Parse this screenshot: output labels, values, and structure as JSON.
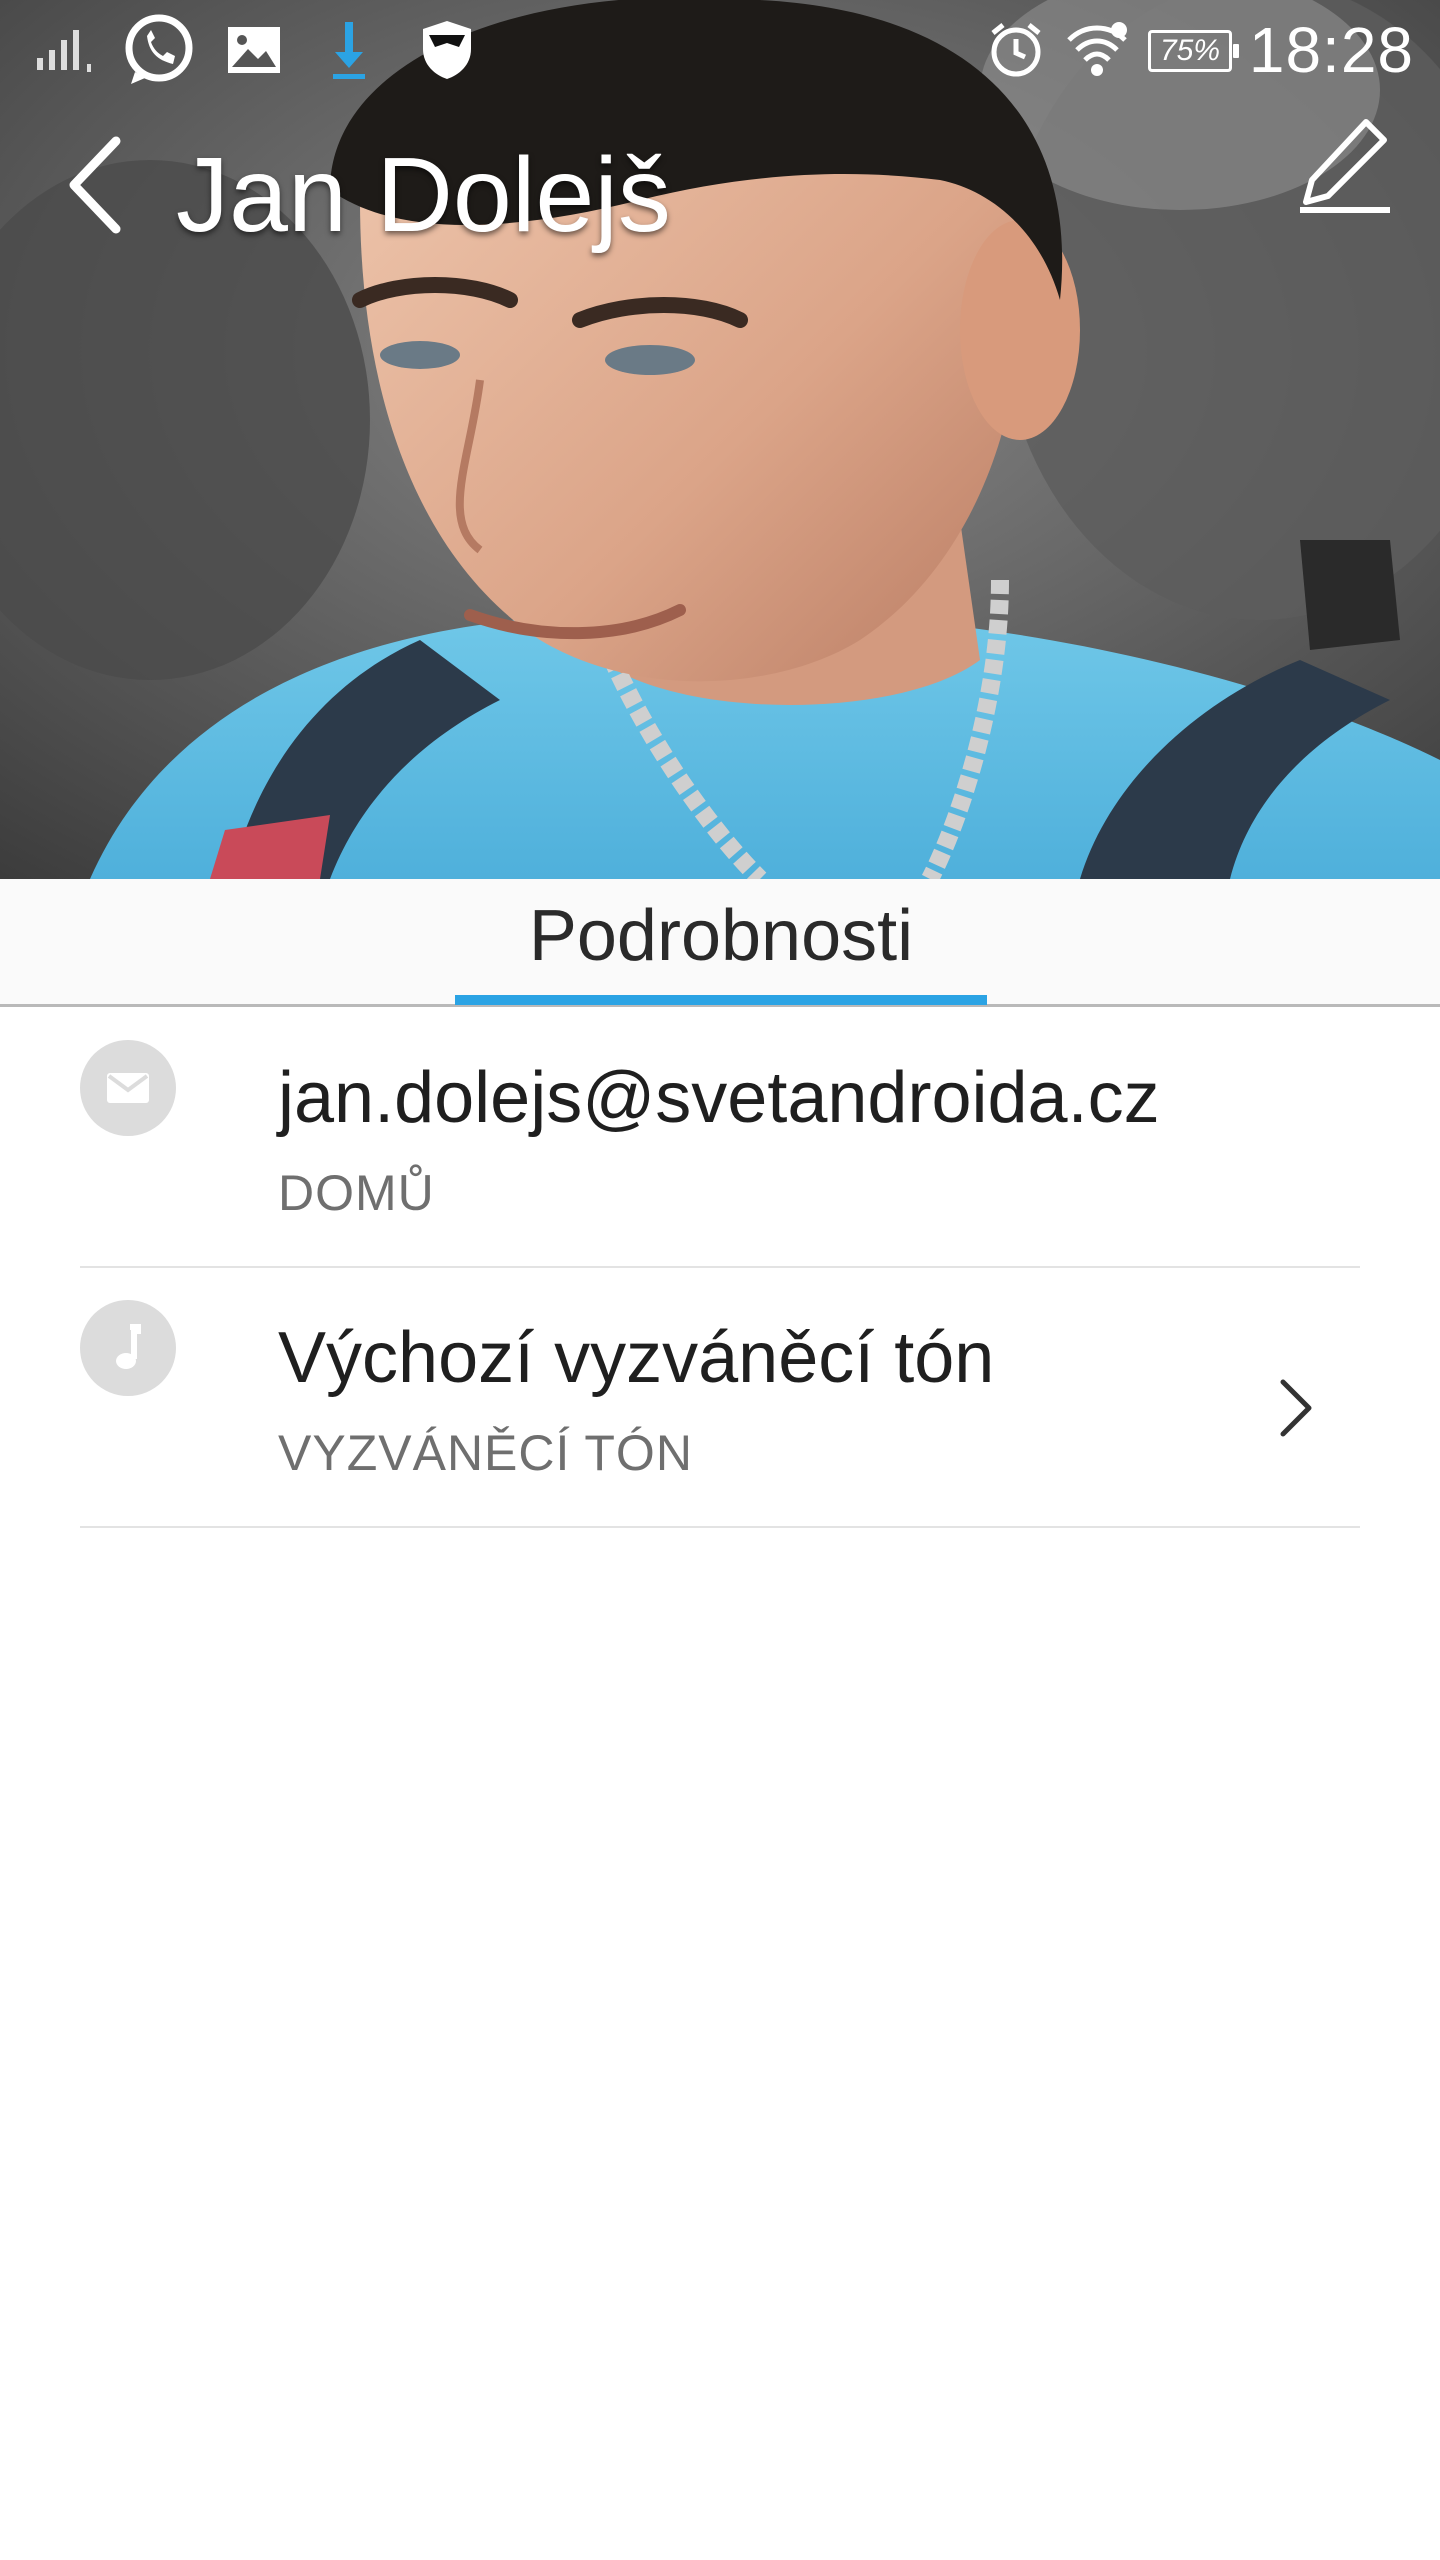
{
  "status_bar": {
    "time": "18:28",
    "battery_percent": "75%",
    "icons": [
      "signal-icon",
      "whatsapp-icon",
      "gallery-icon",
      "download-icon",
      "shield-icon",
      "alarm-icon",
      "wifi-icon",
      "battery-icon"
    ]
  },
  "header": {
    "contact_name": "Jan Dolejš",
    "back_icon": "back-arrow-icon",
    "edit_icon": "edit-pencil-icon"
  },
  "tabs": {
    "active_label": "Podrobnosti",
    "accent_color": "#2ba3e4"
  },
  "details": [
    {
      "icon": "email-icon",
      "value": "jan.dolejs@svetandroida.cz",
      "label": "DOMŮ"
    },
    {
      "icon": "music-note-icon",
      "value": "Výchozí vyzváněcí tón",
      "label": "VYZVÁNĚCÍ TÓN",
      "chevron": "chevron-right-icon"
    }
  ]
}
